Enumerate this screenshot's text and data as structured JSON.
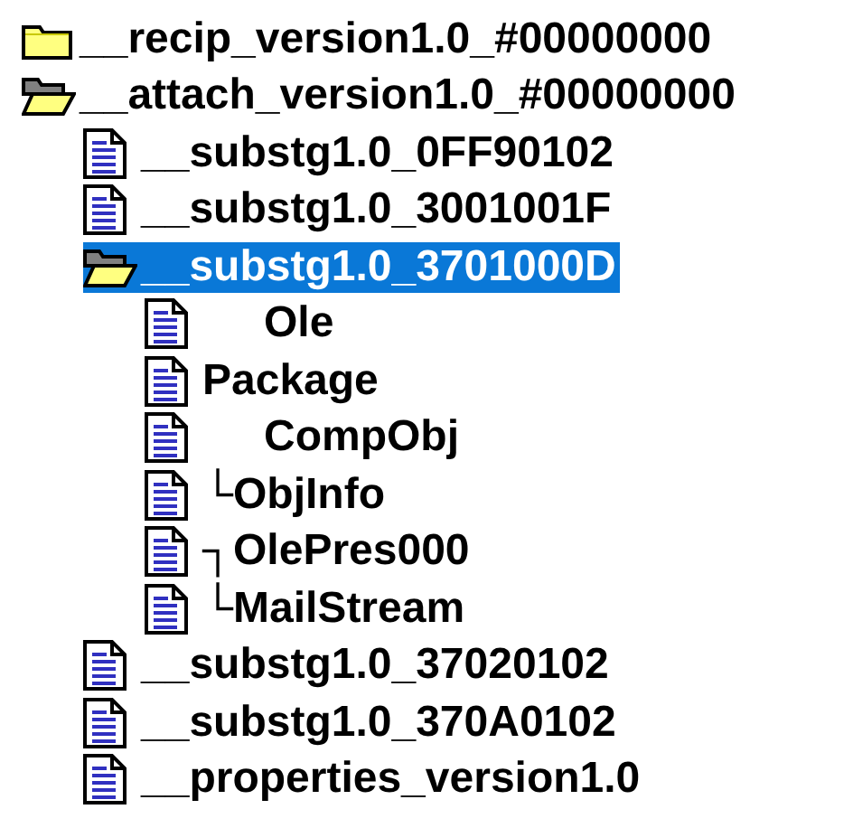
{
  "tree": [
    {
      "label": "__recip_version1.0_#00000000",
      "kind": "folder",
      "expanded": false,
      "selected": false
    },
    {
      "label": "__attach_version1.0_#00000000",
      "kind": "folder",
      "expanded": true,
      "selected": false,
      "children": [
        {
          "label": "__substg1.0_0FF90102",
          "kind": "file",
          "selected": false
        },
        {
          "label": "__substg1.0_3001001F",
          "kind": "file",
          "selected": false
        },
        {
          "label": "__substg1.0_3701000D",
          "kind": "folder",
          "expanded": true,
          "selected": true,
          "children": [
            {
              "label": "Ole",
              "kind": "file",
              "hidden_prefix": true,
              "selected": false
            },
            {
              "label": "Package",
              "kind": "file",
              "selected": false
            },
            {
              "label": "CompObj",
              "kind": "file",
              "hidden_prefix": true,
              "selected": false
            },
            {
              "label": "└ObjInfo",
              "kind": "file",
              "selected": false
            },
            {
              "label": "┐OlePres000",
              "kind": "file",
              "selected": false
            },
            {
              "label": "└MailStream",
              "kind": "file",
              "selected": false
            }
          ]
        },
        {
          "label": "__substg1.0_37020102",
          "kind": "file",
          "selected": false
        },
        {
          "label": "__substg1.0_370A0102",
          "kind": "file",
          "selected": false
        },
        {
          "label": "__properties_version1.0",
          "kind": "file",
          "selected": false
        }
      ]
    }
  ]
}
